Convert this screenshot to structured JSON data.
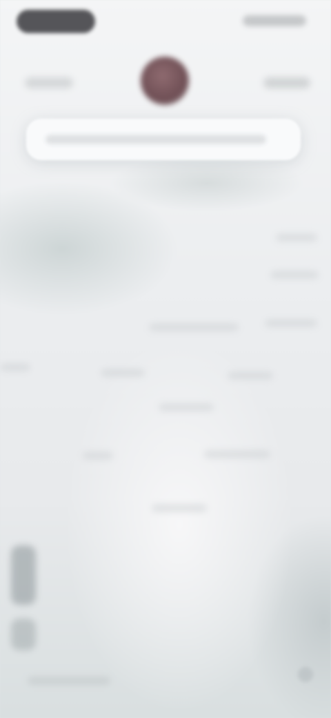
{
  "status_bar": {
    "time": "",
    "indicators": ""
  },
  "header": {
    "left_action": "",
    "right_action": ""
  },
  "search": {
    "placeholder": ""
  },
  "list": {
    "rows": [
      "",
      "",
      "",
      "",
      "",
      "",
      "",
      "",
      "",
      "",
      ""
    ]
  },
  "colors": {
    "avatar": "#7d5b61",
    "background": "#eceef0",
    "search_bg": "#fafbfc"
  },
  "icons": {
    "avatar": "avatar-icon",
    "side_tools": "tool-icon"
  }
}
